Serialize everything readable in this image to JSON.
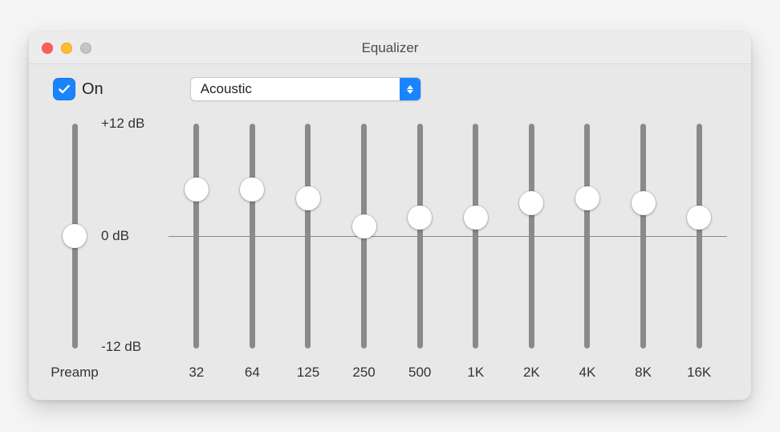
{
  "window": {
    "title": "Equalizer"
  },
  "toggle": {
    "label": "On",
    "checked": true
  },
  "preset": {
    "selected": "Acoustic"
  },
  "scale": {
    "max_label": "+12 dB",
    "mid_label": "0 dB",
    "min_label": "-12 dB"
  },
  "preamp": {
    "label": "Preamp",
    "value": 0
  },
  "bands": [
    {
      "freq": "32",
      "value": 5.0
    },
    {
      "freq": "64",
      "value": 5.0
    },
    {
      "freq": "125",
      "value": 4.0
    },
    {
      "freq": "250",
      "value": 1.0
    },
    {
      "freq": "500",
      "value": 2.0
    },
    {
      "freq": "1K",
      "value": 2.0
    },
    {
      "freq": "2K",
      "value": 3.5
    },
    {
      "freq": "4K",
      "value": 4.0
    },
    {
      "freq": "8K",
      "value": 3.5
    },
    {
      "freq": "16K",
      "value": 2.0
    }
  ],
  "range": {
    "min": -12,
    "max": 12
  }
}
